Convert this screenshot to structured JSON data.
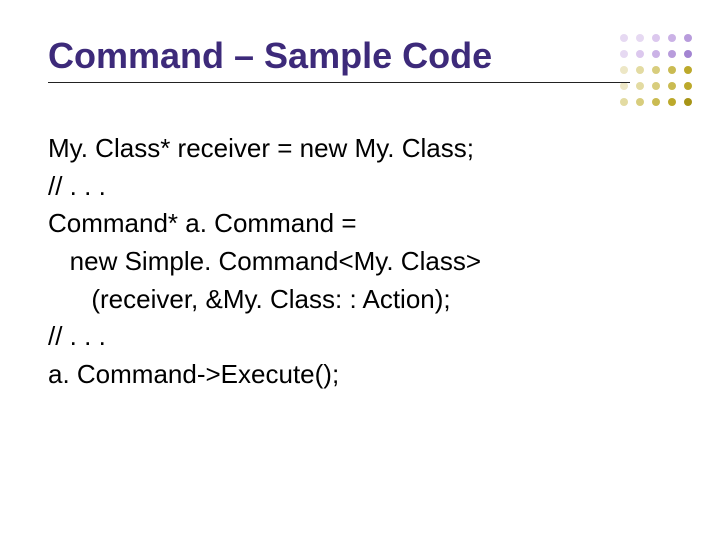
{
  "title": "Command – Sample Code",
  "code": {
    "l1": "My. Class* receiver = new My. Class;",
    "l2": "// . . .",
    "l3": "Command* a. Command =",
    "l4": "   new Simple. Command<My. Class>",
    "l5": "      (receiver, &My. Class: : Action);",
    "l6": "// . . .",
    "l7": "a. Command->Execute();"
  }
}
